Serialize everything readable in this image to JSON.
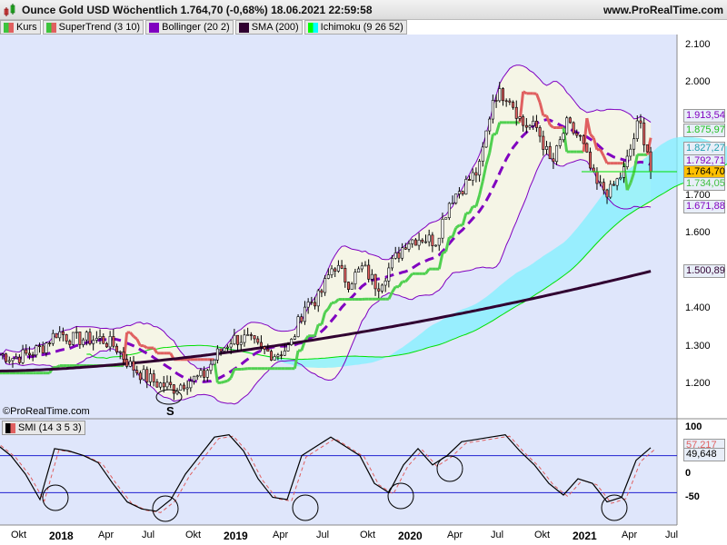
{
  "header": {
    "title": "Ounce Gold USD Wöchentlich 1.764,70 (-0,68%) 18.06.2021 22:59:58",
    "site": "www.ProRealTime.com"
  },
  "legend": [
    {
      "label": "Kurs",
      "colors": [
        "#3cc43c",
        "#e06060"
      ]
    },
    {
      "label": "SuperTrend (3 10)",
      "colors": [
        "#3cc43c",
        "#e06060"
      ]
    },
    {
      "label": "Bollinger (20 2)",
      "colors": [
        "#8000c0"
      ]
    },
    {
      "label": "SMA (200)",
      "colors": [
        "#300030"
      ]
    },
    {
      "label": "Ichimoku (9 26 52)",
      "colors": [
        "#00ff00",
        "#00ffff"
      ]
    }
  ],
  "copyright": "©ProRealTime.com",
  "annotation": "S",
  "price_axis": [
    "2.100",
    "2.000",
    "1.700",
    "1.600",
    "1.400",
    "1.300",
    "1.200"
  ],
  "price_axis_values": [
    2.1,
    2.0,
    1.7,
    1.6,
    1.4,
    1.3,
    1.2
  ],
  "price_tags": [
    {
      "text": "1.913,54",
      "value": 1.9135,
      "color": "#8000c0"
    },
    {
      "text": "1.875,97",
      "value": 1.876,
      "color": "#20c020"
    },
    {
      "text": "1.827,27",
      "value": 1.8273,
      "color": "#20a0b0"
    },
    {
      "text": "1.792,71",
      "value": 1.7927,
      "color": "#8000c0"
    },
    {
      "text": "1.764,70",
      "value": 1.7647,
      "color": "#000000",
      "bg": "#ffc000"
    },
    {
      "text": "1.734,05",
      "value": 1.734,
      "color": "#40c040"
    },
    {
      "text": "1.671,88",
      "value": 1.6719,
      "color": "#8000c0"
    },
    {
      "text": "1.500,89",
      "value": 1.5009,
      "color": "#300030"
    }
  ],
  "smi": {
    "label": "SMI (14 3 5 3)",
    "axis": [
      "100",
      "0",
      "-50"
    ],
    "axis_values": [
      100,
      0,
      -50
    ],
    "tags": [
      {
        "text": "57,217",
        "value": 57.2,
        "color": "#e06060"
      },
      {
        "text": "49,648",
        "value": 49.6,
        "color": "#000"
      }
    ]
  },
  "x_axis": [
    {
      "label": "Okt",
      "month": 1,
      "bold": false
    },
    {
      "label": "2018",
      "month": 4,
      "bold": true
    },
    {
      "label": "Apr",
      "month": 7,
      "bold": false
    },
    {
      "label": "Jul",
      "month": 10,
      "bold": false
    },
    {
      "label": "Okt",
      "month": 13,
      "bold": false
    },
    {
      "label": "2019",
      "month": 16,
      "bold": true
    },
    {
      "label": "Apr",
      "month": 19,
      "bold": false
    },
    {
      "label": "Jul",
      "month": 22,
      "bold": false
    },
    {
      "label": "Okt",
      "month": 25,
      "bold": false
    },
    {
      "label": "2020",
      "month": 28,
      "bold": true
    },
    {
      "label": "Apr",
      "month": 31,
      "bold": false
    },
    {
      "label": "Jul",
      "month": 34,
      "bold": false
    },
    {
      "label": "Okt",
      "month": 37,
      "bold": false
    },
    {
      "label": "2021",
      "month": 40,
      "bold": true
    },
    {
      "label": "Apr",
      "month": 43,
      "bold": false
    },
    {
      "label": "Jul",
      "month": 46,
      "bold": false
    }
  ],
  "chart_data": {
    "type": "candlestick",
    "title": "Ounce Gold USD Wöchentlich",
    "start": "2017-09",
    "monthly_close": [
      1.28,
      1.27,
      1.28,
      1.3,
      1.34,
      1.32,
      1.32,
      1.32,
      1.3,
      1.25,
      1.22,
      1.2,
      1.19,
      1.21,
      1.22,
      1.28,
      1.32,
      1.32,
      1.29,
      1.28,
      1.3,
      1.41,
      1.43,
      1.52,
      1.47,
      1.51,
      1.46,
      1.52,
      1.58,
      1.59,
      1.58,
      1.69,
      1.73,
      1.77,
      1.97,
      1.97,
      1.89,
      1.88,
      1.78,
      1.89,
      1.85,
      1.73,
      1.71,
      1.77,
      1.9,
      1.765
    ],
    "sma200": [
      1.235,
      1.5
    ],
    "ylim": [
      1.15,
      2.13
    ],
    "smi_monthly": [
      65,
      40,
      0,
      -55,
      55,
      50,
      40,
      25,
      -20,
      -60,
      -75,
      -80,
      -55,
      0,
      40,
      80,
      85,
      50,
      -10,
      -50,
      -55,
      40,
      60,
      80,
      60,
      40,
      -20,
      -40,
      20,
      55,
      20,
      40,
      70,
      75,
      80,
      85,
      50,
      20,
      -20,
      -45,
      -10,
      -20,
      -60,
      -50,
      30,
      57
    ],
    "smi_levels": [
      40,
      -40
    ],
    "smi_ylim": [
      -100,
      115
    ]
  }
}
